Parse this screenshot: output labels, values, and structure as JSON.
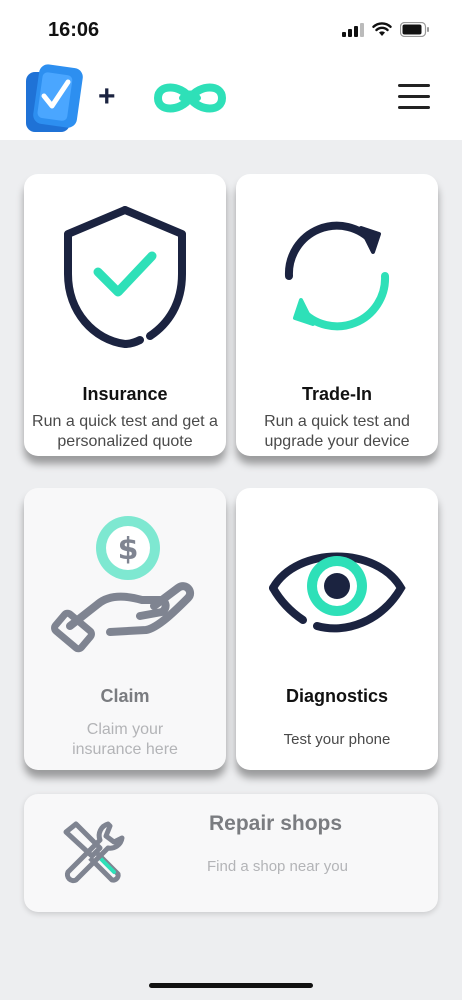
{
  "status_bar": {
    "time": "16:06",
    "icons": [
      "cellular-signal-icon",
      "wifi-icon",
      "battery-icon"
    ]
  },
  "header": {
    "app_logo": "phone-check-logo",
    "plus": "+",
    "partner_logo": "infinity-logo",
    "menu_icon": "hamburger-menu-icon"
  },
  "colors": {
    "navy": "#1b2340",
    "mint": "#2ee0b8",
    "gray": "#7f8491",
    "light_bg": "#edeef0"
  },
  "cards": [
    {
      "title": "Insurance",
      "description": "Run a quick test and get a personalized quote",
      "icon": "shield-check-icon",
      "enabled": true
    },
    {
      "title": "Trade-In",
      "description": "Run a quick test and upgrade your device",
      "icon": "sync-arrows-icon",
      "enabled": true
    },
    {
      "title": "Claim",
      "description": "Claim your insurance here",
      "icon": "hand-coin-icon",
      "enabled": false
    },
    {
      "title": "Diagnostics",
      "description": "Test your phone",
      "icon": "eye-icon",
      "enabled": true
    }
  ],
  "repair": {
    "title": "Repair shops",
    "description": "Find a shop near you",
    "icon": "tools-icon",
    "enabled": false
  }
}
